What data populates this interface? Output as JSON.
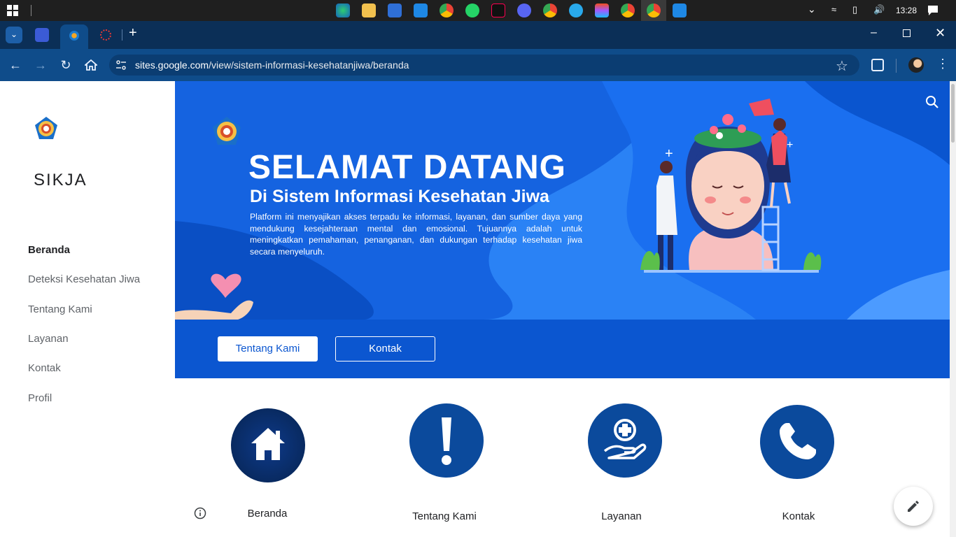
{
  "taskbar": {
    "time": "13:28"
  },
  "browser": {
    "url_host": "sites.google.com",
    "url_path": "/view/sistem-informasi-kesehatanjiwa/beranda"
  },
  "sidebar": {
    "site_title": "SIKJA",
    "items": [
      {
        "label": "Beranda",
        "active": true
      },
      {
        "label": "Deteksi Kesehatan Jiwa",
        "active": false
      },
      {
        "label": "Tentang Kami",
        "active": false
      },
      {
        "label": "Layanan",
        "active": false
      },
      {
        "label": "Kontak",
        "active": false
      },
      {
        "label": "Profil",
        "active": false
      }
    ]
  },
  "hero": {
    "title": "SELAMAT DATANG",
    "subtitle": "Di Sistem Informasi Kesehatan Jiwa",
    "description": "Platform ini menyajikan akses terpadu ke informasi, layanan, dan sumber daya yang mendukung kesejahteraan mental dan emosional. Tujuannya adalah untuk meningkatkan pemahaman, penanganan, dan dukungan terhadap kesehatan jiwa secara menyeluruh.",
    "button_primary": "Tentang Kami",
    "button_secondary": "Kontak"
  },
  "features": [
    {
      "label": "Beranda",
      "icon": "home-icon"
    },
    {
      "label": "Tentang Kami",
      "icon": "exclamation-icon"
    },
    {
      "label": "Layanan",
      "icon": "medical-hand-icon"
    },
    {
      "label": "Kontak",
      "icon": "phone-icon"
    }
  ],
  "colors": {
    "hero_bg": "#0b56d0",
    "feature_circle": "#0b4a9c",
    "browser_toolbar": "#0f4c8a"
  }
}
